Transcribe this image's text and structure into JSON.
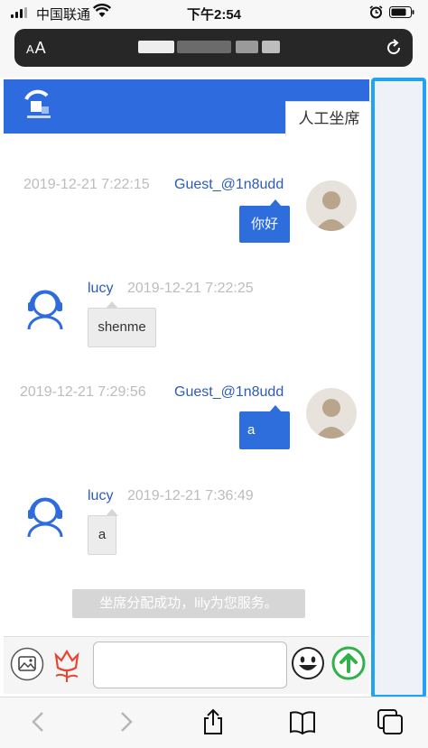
{
  "status_bar": {
    "carrier": "中国联通",
    "time": "下午2:54"
  },
  "browser": {
    "text_size_label": "A",
    "text_size_label_large": "A"
  },
  "chat": {
    "tabs": {
      "agent_label": "人工坐席"
    },
    "messages": [
      {
        "sender": "Guest_@1n8udd",
        "time": "2019-12-21 7:22:15",
        "text": "你好",
        "side": "right"
      },
      {
        "sender": "lucy",
        "time": "2019-12-21 7:22:25",
        "text": "shenme",
        "side": "left"
      },
      {
        "sender": "Guest_@1n8udd",
        "time": "2019-12-21 7:29:56",
        "text": "a",
        "side": "right"
      },
      {
        "sender": "lucy",
        "time": "2019-12-21 7:36:49",
        "text": "a",
        "side": "left"
      }
    ],
    "system_notice": "坐席分配成功，lily为您服务。",
    "input": {
      "value": ""
    }
  },
  "colors": {
    "header_blue": "#2d6bde",
    "bubble_blue": "#2e6edc",
    "name_blue": "#2d5cb5",
    "highlight_border": "#20a3f2",
    "send_green": "#2fb24a",
    "flower_red": "#e8442f"
  },
  "icons": {
    "image_button": "image-icon",
    "flower_button": "flower-icon",
    "emoji_button": "smiley-icon",
    "send_button": "arrow-up-icon",
    "back": "chevron-left-icon",
    "forward": "chevron-right-icon",
    "share": "share-icon",
    "bookmarks": "book-icon",
    "tabs": "tabs-icon"
  }
}
